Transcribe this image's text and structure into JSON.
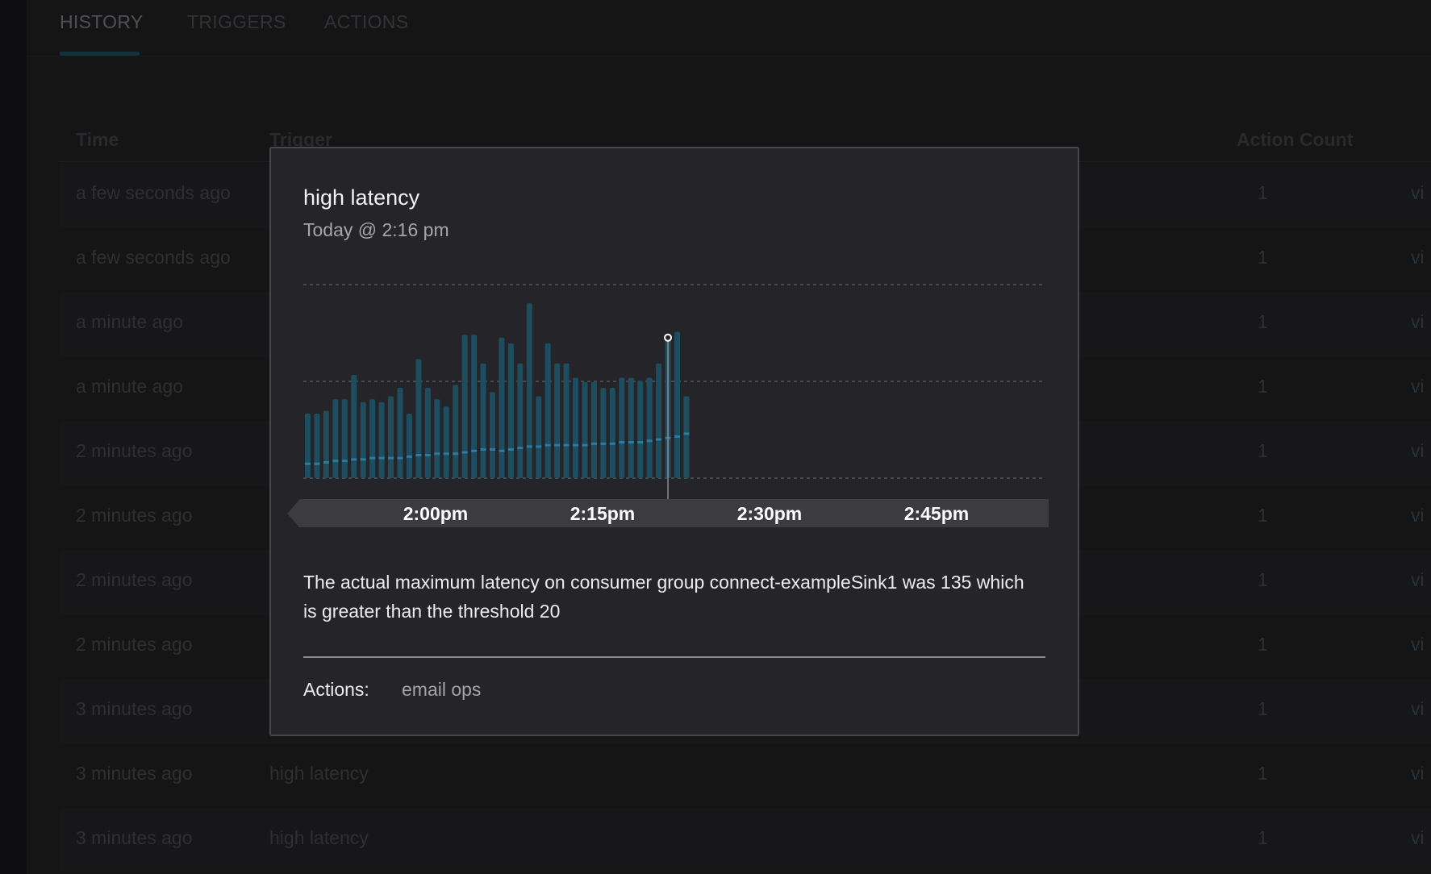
{
  "tabs": [
    {
      "label": "HISTORY",
      "active": true
    },
    {
      "label": "TRIGGERS",
      "active": false
    },
    {
      "label": "ACTIONS",
      "active": false
    }
  ],
  "table": {
    "headers": {
      "time": "Time",
      "trigger": "Trigger",
      "action_count": "Action Count"
    },
    "rows": [
      {
        "time": "a few seconds ago",
        "trigger": "",
        "count": "1",
        "link": "vi"
      },
      {
        "time": "a few seconds ago",
        "trigger": "",
        "count": "1",
        "link": "vi"
      },
      {
        "time": "a minute ago",
        "trigger": "",
        "count": "1",
        "link": "vi"
      },
      {
        "time": "a minute ago",
        "trigger": "",
        "count": "1",
        "link": "vi"
      },
      {
        "time": "2 minutes ago",
        "trigger": "",
        "count": "1",
        "link": "vi"
      },
      {
        "time": "2 minutes ago",
        "trigger": "",
        "count": "1",
        "link": "vi"
      },
      {
        "time": "2 minutes ago",
        "trigger": "",
        "count": "1",
        "link": "vi"
      },
      {
        "time": "2 minutes ago",
        "trigger": "",
        "count": "1",
        "link": "vi"
      },
      {
        "time": "3 minutes ago",
        "trigger": "",
        "count": "1",
        "link": "vi"
      },
      {
        "time": "3 minutes ago",
        "trigger": "high latency",
        "count": "1",
        "link": "vi"
      },
      {
        "time": "3 minutes ago",
        "trigger": "high latency",
        "count": "1",
        "link": "vi"
      }
    ]
  },
  "modal": {
    "title": "high latency",
    "subtitle": "Today @ 2:16 pm",
    "message": "The actual maximum latency on consumer group connect-exampleSink1 was 135 which is greater than the threshold 20",
    "actions_label": "Actions:",
    "actions_value": "email ops"
  },
  "colors": {
    "bar": "#1f4d60",
    "bar_marker": "#2a7da0",
    "grid": "#55555b",
    "axis_band": "#3b3b40",
    "cursor_line": "#8d8d92"
  },
  "chart_data": {
    "type": "bar",
    "x_tick_labels": [
      "2:00pm",
      "2:15pm",
      "2:30pm",
      "2:45pm"
    ],
    "highlighted_time": "2:16pm",
    "series": [
      {
        "values": [
          45,
          45,
          47,
          55,
          55,
          72,
          53,
          55,
          53,
          57,
          63,
          45,
          83,
          63,
          55,
          50,
          65,
          100,
          100,
          80,
          60,
          98,
          94,
          80,
          122,
          57,
          94,
          80,
          80,
          70,
          67,
          67,
          63,
          63,
          70,
          70,
          68,
          70,
          80,
          98,
          102,
          57
        ],
        "markers": [
          10,
          10,
          11,
          12,
          12,
          13,
          13,
          14,
          14,
          14,
          14,
          15,
          16,
          16,
          17,
          17,
          17,
          18,
          19,
          20,
          20,
          19,
          20,
          21,
          22,
          22,
          23,
          23,
          23,
          23,
          23,
          24,
          24,
          24,
          25,
          25,
          25,
          26,
          27,
          28,
          29,
          31
        ]
      }
    ],
    "grid": true
  }
}
